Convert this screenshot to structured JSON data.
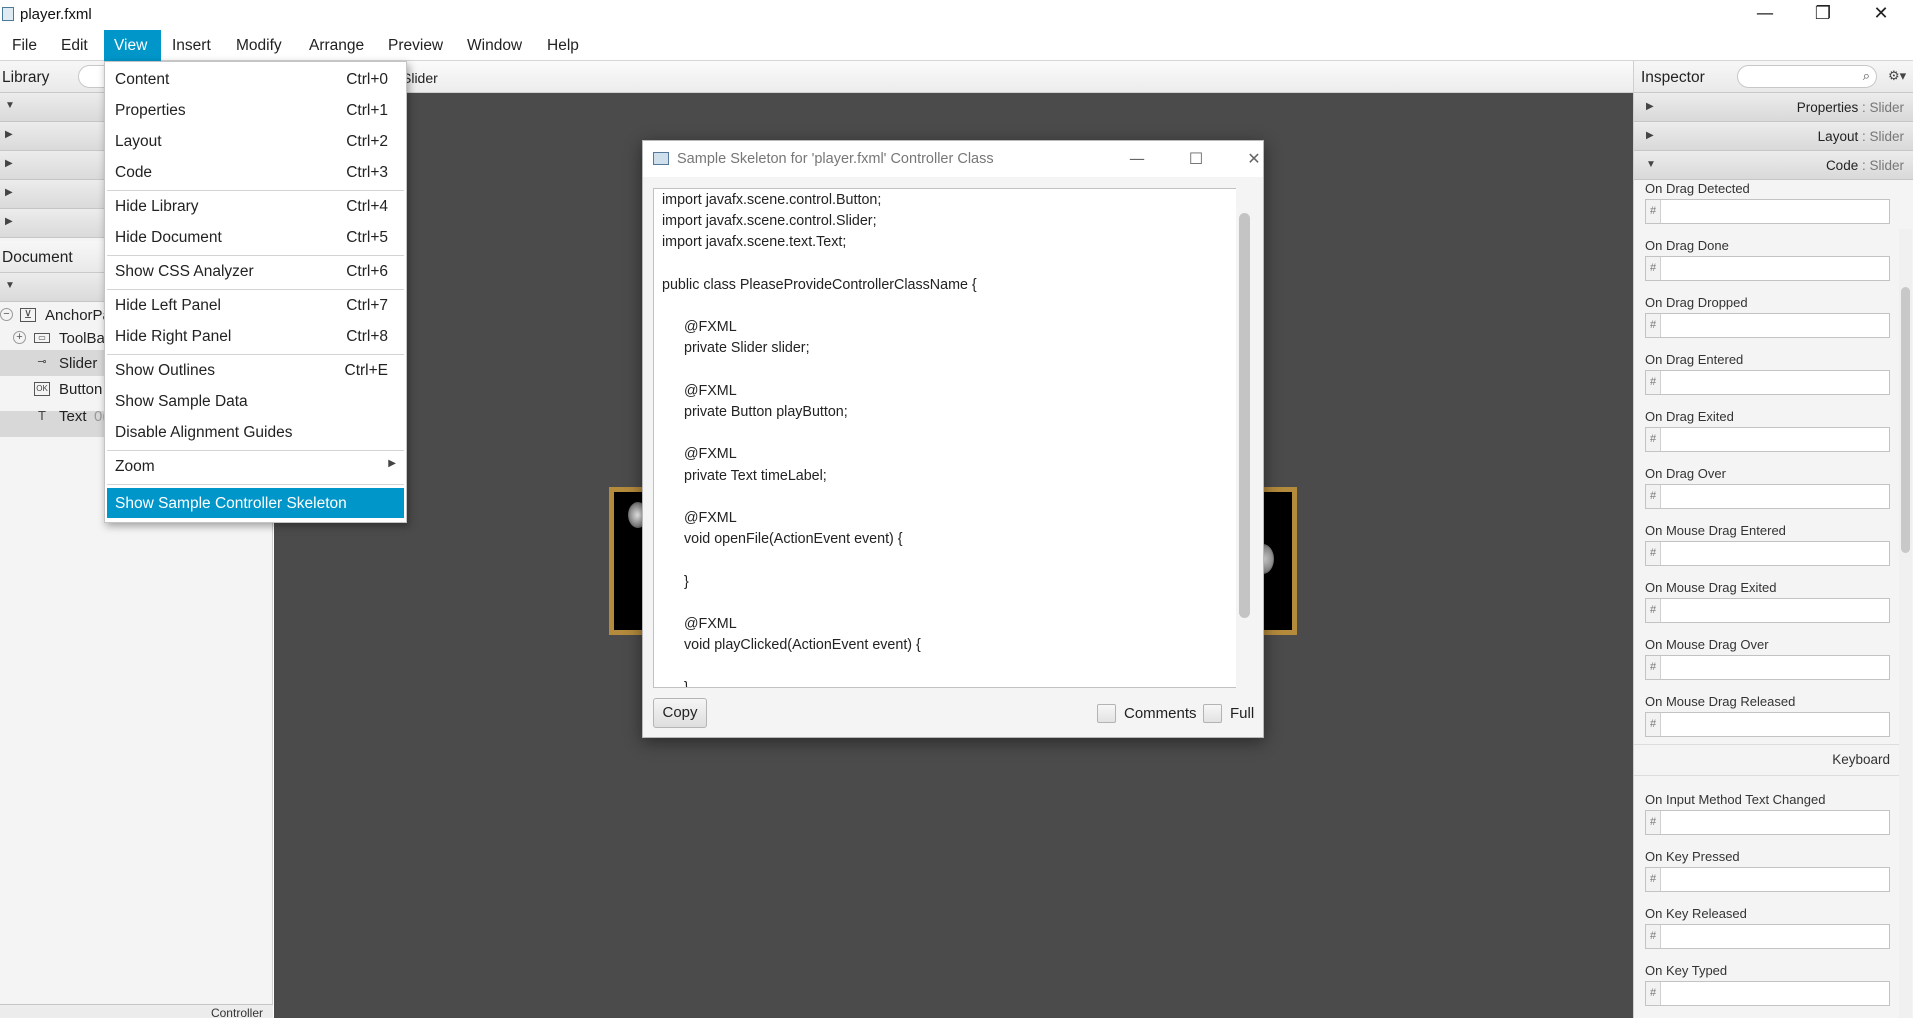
{
  "window": {
    "title": "player.fxml",
    "minimize": "—",
    "restore": "❐",
    "close": "✕"
  },
  "menubar": [
    "File",
    "Edit",
    "View",
    "Insert",
    "Modify",
    "Arrange",
    "Preview",
    "Window",
    "Help"
  ],
  "left": {
    "library_label": "Library",
    "document_label": "Document",
    "tree": [
      {
        "label": "AnchorPa",
        "icon": "anchorpane-icon"
      },
      {
        "label": "ToolBa",
        "icon": "toolbar-icon"
      },
      {
        "label": "Slider",
        "icon": "slider-icon"
      },
      {
        "label": "Button",
        "icon": "button-icon"
      },
      {
        "label": "Text",
        "extra": "0(",
        "icon": "text-icon"
      }
    ],
    "controller_label": "Controller"
  },
  "canvas": {
    "crumb": "Slider"
  },
  "view_menu": [
    {
      "label": "Content",
      "shortcut": "Ctrl+0"
    },
    {
      "label": "Properties",
      "shortcut": "Ctrl+1"
    },
    {
      "label": "Layout",
      "shortcut": "Ctrl+2"
    },
    {
      "label": "Code",
      "shortcut": "Ctrl+3"
    },
    {
      "label": "Hide Library",
      "shortcut": "Ctrl+4"
    },
    {
      "label": "Hide Document",
      "shortcut": "Ctrl+5"
    },
    {
      "label": "Show CSS Analyzer",
      "shortcut": "Ctrl+6"
    },
    {
      "label": "Hide Left Panel",
      "shortcut": "Ctrl+7"
    },
    {
      "label": "Hide Right Panel",
      "shortcut": "Ctrl+8"
    },
    {
      "label": "Show Outlines",
      "shortcut": "Ctrl+E"
    },
    {
      "label": "Show Sample Data",
      "shortcut": ""
    },
    {
      "label": "Disable Alignment Guides",
      "shortcut": ""
    },
    {
      "label": "Zoom",
      "shortcut": ""
    },
    {
      "label": "Show Sample Controller Skeleton",
      "shortcut": ""
    }
  ],
  "dialog": {
    "title": "Sample Skeleton for 'player.fxml' Controller Class",
    "code_lines": [
      "import javafx.scene.control.Button;",
      "import javafx.scene.control.Slider;",
      "import javafx.scene.text.Text;",
      "",
      "public class PleaseProvideControllerClassName {",
      "",
      "    @FXML",
      "    private Slider slider;",
      "",
      "    @FXML",
      "    private Button playButton;",
      "",
      "    @FXML",
      "    private Text timeLabel;",
      "",
      "    @FXML",
      "    void openFile(ActionEvent event) {",
      "",
      "    }",
      "",
      "    @FXML",
      "    void playClicked(ActionEvent event) {",
      "",
      "    }"
    ],
    "copy_label": "Copy",
    "comments_label": "Comments",
    "full_label": "Full"
  },
  "inspector": {
    "label": "Inspector",
    "sections": [
      {
        "name": "Properties",
        "target": "Slider"
      },
      {
        "name": "Layout",
        "target": "Slider"
      },
      {
        "name": "Code",
        "target": "Slider"
      }
    ],
    "separator": " : ",
    "events_top": [
      "On Drag Detected",
      "On Drag Done",
      "On Drag Dropped",
      "On Drag Entered",
      "On Drag Exited",
      "On Drag Over",
      "On Mouse Drag Entered",
      "On Mouse Drag Exited",
      "On Mouse Drag Over",
      "On Mouse Drag Released"
    ],
    "keyboard_heading": "Keyboard",
    "events_keyboard": [
      "On Input Method Text Changed",
      "On Key Pressed",
      "On Key Released",
      "On Key Typed"
    ],
    "hash": "#"
  }
}
